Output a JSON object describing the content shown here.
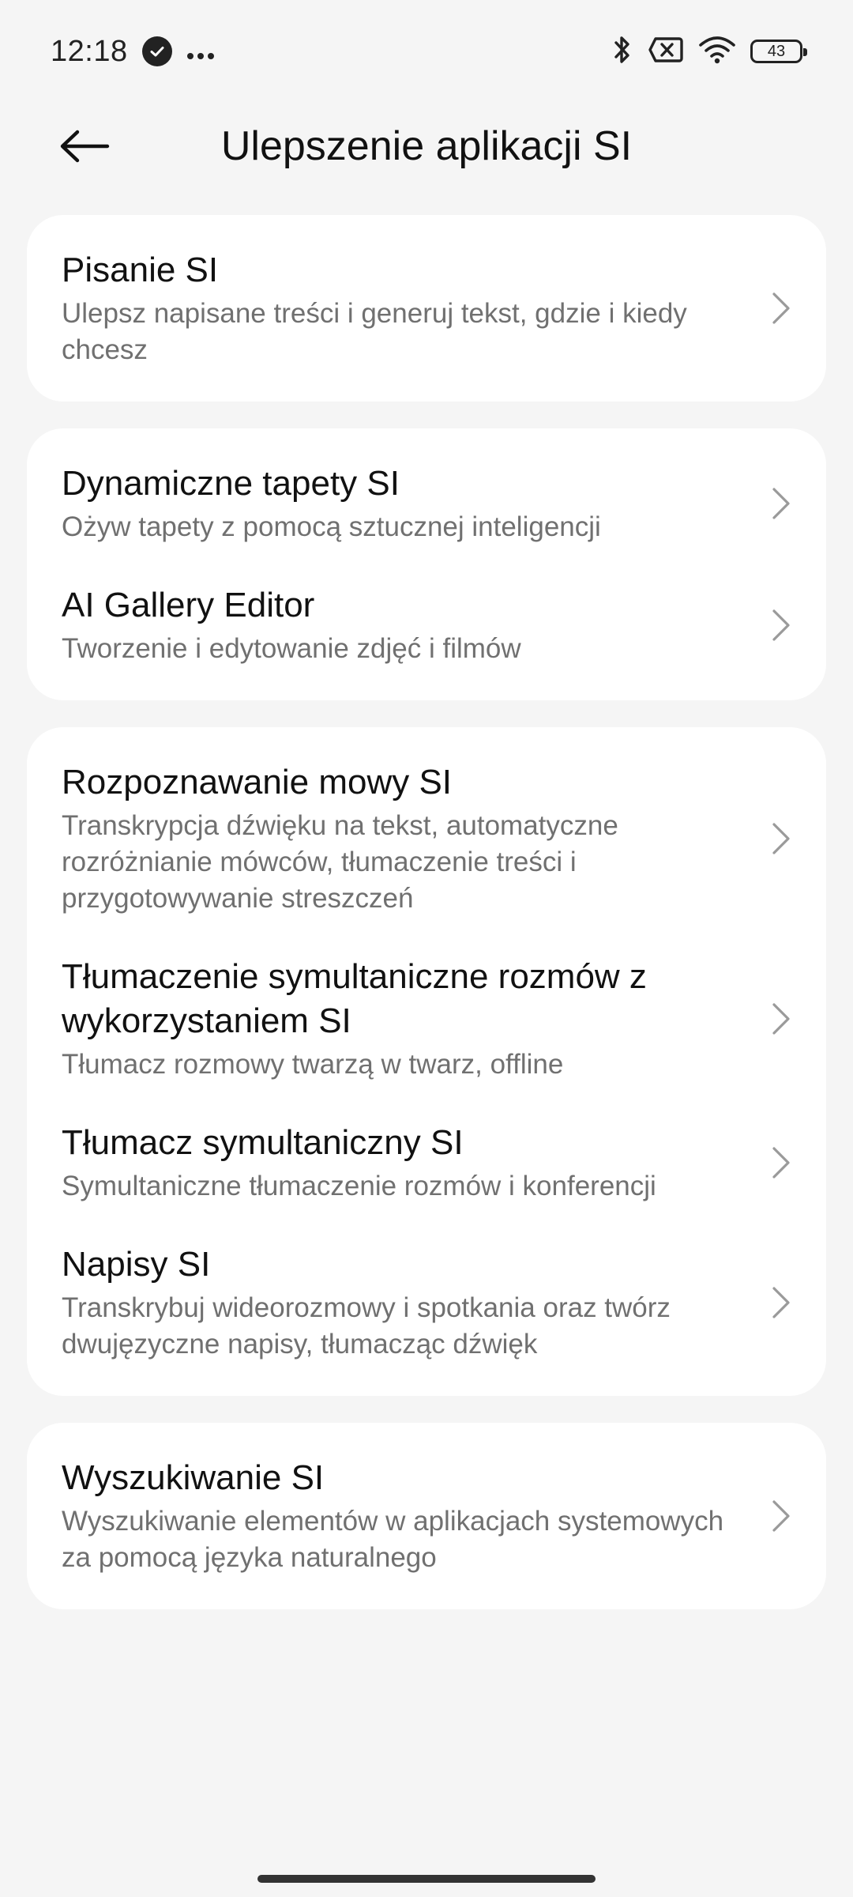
{
  "status_bar": {
    "time": "12:18",
    "battery": "43",
    "icons": [
      "check-circle-icon",
      "more-dots-icon",
      "bluetooth-icon",
      "no-sim-icon",
      "wifi-icon",
      "battery-icon"
    ]
  },
  "header": {
    "title": "Ulepszenie aplikacji SI",
    "back_icon": "arrow-left-icon"
  },
  "cards": [
    {
      "items": [
        {
          "title": "Pisanie SI",
          "subtitle": "Ulepsz napisane treści i generuj tekst, gdzie i kiedy chcesz"
        }
      ]
    },
    {
      "items": [
        {
          "title": "Dynamiczne tapety SI",
          "subtitle": "Ożyw tapety z pomocą sztucznej inteligencji"
        },
        {
          "title": "AI Gallery Editor",
          "subtitle": "Tworzenie i edytowanie zdjęć i filmów"
        }
      ]
    },
    {
      "items": [
        {
          "title": "Rozpoznawanie mowy SI",
          "subtitle": "Transkrypcja dźwięku na tekst, automatyczne rozróżnianie mówców, tłumaczenie treści i przygotowywanie streszczeń"
        },
        {
          "title": "Tłumaczenie symultaniczne rozmów z wykorzystaniem SI",
          "subtitle": "Tłumacz rozmowy twarzą w twarz, offline"
        },
        {
          "title": "Tłumacz symultaniczny SI",
          "subtitle": "Symultaniczne tłumaczenie rozmów i konferencji"
        },
        {
          "title": "Napisy SI",
          "subtitle": "Transkrybuj wideorozmowy i spotkania oraz twórz dwujęzyczne napisy, tłumacząc dźwięk"
        }
      ]
    },
    {
      "items": [
        {
          "title": "Wyszukiwanie SI",
          "subtitle": "Wyszukiwanie elementów w aplikacjach systemowych za pomocą języka naturalnego"
        }
      ]
    }
  ],
  "colors": {
    "background": "#f5f5f5",
    "card": "#ffffff",
    "title_text": "#111111",
    "subtitle_text": "#707070",
    "chevron": "#9a9a9a"
  }
}
